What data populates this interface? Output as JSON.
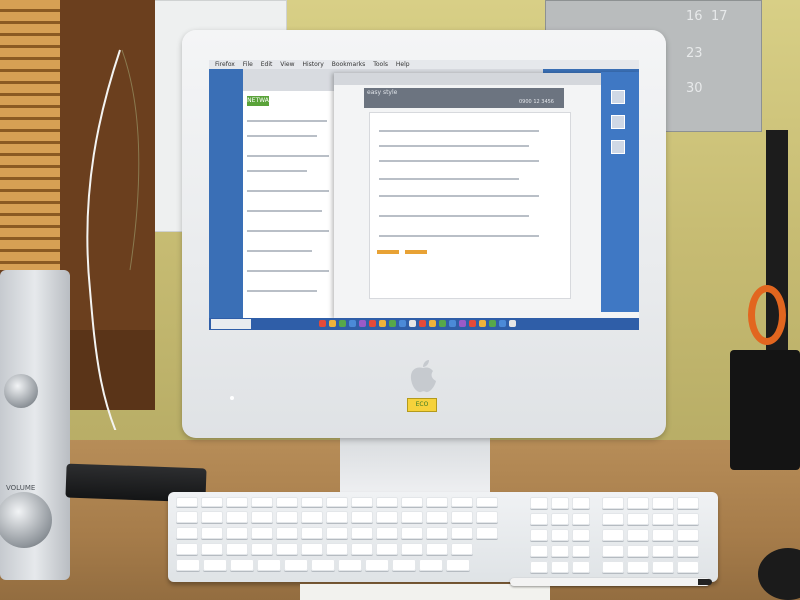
{
  "scene": {
    "description_free": true
  },
  "wall": {
    "calendar_numbers": [
      "16",
      "17",
      "23",
      "30"
    ]
  },
  "screen": {
    "menubar": [
      "Firefox",
      "File",
      "Edit",
      "View",
      "History",
      "Bookmarks",
      "Tools",
      "Help"
    ],
    "back_window": {
      "tag": "NETWA"
    },
    "front_window": {
      "banner_title": "easy style",
      "banner_phone": "0900 12 3456"
    }
  },
  "imac": {
    "logo": "",
    "sticker_text": "ECO"
  },
  "stereo": {
    "label": "VOLUME"
  },
  "colors": {
    "wall": "#c6bb72",
    "desk": "#a67c4a",
    "screen_desktop": "#3a6fb6",
    "imac_body": "#e9ebed",
    "scissors": "#e2661f"
  }
}
